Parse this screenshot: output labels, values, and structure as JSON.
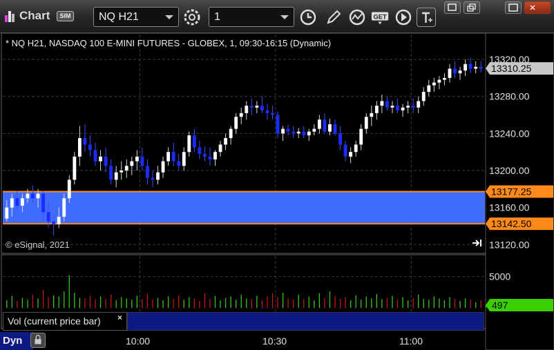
{
  "window": {
    "title": "Chart",
    "badge": "SIM",
    "symbol": "NQ H21",
    "interval": "1",
    "toolbar_icons": [
      "settings-gear-icon",
      "clock-icon",
      "pencil-icon",
      "study-icon",
      "get-icon",
      "play-icon",
      "text-icon"
    ],
    "window_icons": [
      "restore-icon",
      "maximize-icon",
      "minimize-icon",
      "close-icon"
    ],
    "get_label": "GET"
  },
  "chart_data": {
    "type": "candlestick",
    "title": "* NQ H21, NASDAQ 100 E-MINI FUTURES - GLOBEX, 1, 09:30-16:15 (Dynamic)",
    "copyright": "© eSignal, 2021",
    "y_ticks": [
      "13320.00",
      "13280.00",
      "13240.00",
      "13200.00",
      "13160.00",
      "13120.00"
    ],
    "y_tick_values": [
      13320,
      13280,
      13240,
      13200,
      13160,
      13120
    ],
    "ylim": [
      13112,
      13332
    ],
    "x_ticks": [
      "10:00",
      "10:30",
      "11:00"
    ],
    "x_tick_values": [
      "10:00",
      "10:30",
      "11:00"
    ],
    "x_range": [
      "09:30",
      "11:16"
    ],
    "last_price": "13310.25",
    "range_zone": {
      "high": 13177.25,
      "low": 13142.5,
      "high_label": "13177.25",
      "low_label": "13142.50",
      "color": "#3f6bff"
    },
    "up_color": "#ffffff",
    "down_color": "#1a2cff",
    "candles": [
      [
        13148,
        13168,
        13145,
        13160
      ],
      [
        13160,
        13175,
        13150,
        13170
      ],
      [
        13170,
        13178,
        13158,
        13162
      ],
      [
        13162,
        13175,
        13155,
        13170
      ],
      [
        13170,
        13180,
        13165,
        13175
      ],
      [
        13175,
        13184,
        13165,
        13170
      ],
      [
        13170,
        13180,
        13160,
        13175
      ],
      [
        13175,
        13178,
        13145,
        13155
      ],
      [
        13155,
        13165,
        13138,
        13145
      ],
      [
        13145,
        13150,
        13130,
        13142
      ],
      [
        13142,
        13160,
        13138,
        13150
      ],
      [
        13150,
        13175,
        13145,
        13170
      ],
      [
        13170,
        13195,
        13165,
        13190
      ],
      [
        13190,
        13220,
        13185,
        13215
      ],
      [
        13215,
        13248,
        13205,
        13235
      ],
      [
        13235,
        13250,
        13220,
        13228
      ],
      [
        13228,
        13238,
        13215,
        13222
      ],
      [
        13222,
        13230,
        13205,
        13210
      ],
      [
        13210,
        13222,
        13200,
        13215
      ],
      [
        13215,
        13225,
        13198,
        13205
      ],
      [
        13205,
        13212,
        13185,
        13190
      ],
      [
        13190,
        13205,
        13182,
        13198
      ],
      [
        13198,
        13210,
        13190,
        13200
      ],
      [
        13200,
        13212,
        13192,
        13205
      ],
      [
        13205,
        13215,
        13195,
        13210
      ],
      [
        13210,
        13222,
        13200,
        13215
      ],
      [
        13215,
        13225,
        13200,
        13205
      ],
      [
        13205,
        13212,
        13185,
        13192
      ],
      [
        13192,
        13200,
        13182,
        13190
      ],
      [
        13190,
        13205,
        13185,
        13198
      ],
      [
        13198,
        13215,
        13192,
        13210
      ],
      [
        13210,
        13225,
        13205,
        13220
      ],
      [
        13220,
        13230,
        13205,
        13210
      ],
      [
        13210,
        13218,
        13200,
        13205
      ],
      [
        13205,
        13225,
        13200,
        13220
      ],
      [
        13220,
        13242,
        13215,
        13238
      ],
      [
        13238,
        13245,
        13220,
        13225
      ],
      [
        13225,
        13232,
        13212,
        13218
      ],
      [
        13218,
        13226,
        13210,
        13215
      ],
      [
        13215,
        13225,
        13205,
        13212
      ],
      [
        13212,
        13222,
        13205,
        13220
      ],
      [
        13220,
        13232,
        13215,
        13228
      ],
      [
        13228,
        13240,
        13222,
        13235
      ],
      [
        13235,
        13248,
        13228,
        13245
      ],
      [
        13245,
        13262,
        13240,
        13258
      ],
      [
        13258,
        13268,
        13250,
        13262
      ],
      [
        13262,
        13275,
        13255,
        13270
      ],
      [
        13270,
        13278,
        13260,
        13268
      ],
      [
        13268,
        13275,
        13262,
        13270
      ],
      [
        13270,
        13280,
        13262,
        13265
      ],
      [
        13265,
        13272,
        13255,
        13262
      ],
      [
        13262,
        13270,
        13255,
        13260
      ],
      [
        13260,
        13264,
        13235,
        13240
      ],
      [
        13240,
        13248,
        13232,
        13245
      ],
      [
        13245,
        13250,
        13238,
        13242
      ],
      [
        13242,
        13248,
        13235,
        13240
      ],
      [
        13240,
        13246,
        13235,
        13242
      ],
      [
        13242,
        13248,
        13235,
        13238
      ],
      [
        13238,
        13245,
        13232,
        13242
      ],
      [
        13242,
        13250,
        13238,
        13245
      ],
      [
        13245,
        13260,
        13240,
        13255
      ],
      [
        13255,
        13262,
        13240,
        13242
      ],
      [
        13242,
        13256,
        13238,
        13250
      ],
      [
        13250,
        13255,
        13238,
        13240
      ],
      [
        13240,
        13248,
        13222,
        13228
      ],
      [
        13228,
        13232,
        13210,
        13215
      ],
      [
        13215,
        13225,
        13208,
        13220
      ],
      [
        13220,
        13232,
        13215,
        13228
      ],
      [
        13228,
        13250,
        13222,
        13245
      ],
      [
        13245,
        13262,
        13240,
        13258
      ],
      [
        13258,
        13270,
        13248,
        13262
      ],
      [
        13262,
        13275,
        13255,
        13270
      ],
      [
        13270,
        13282,
        13262,
        13275
      ],
      [
        13275,
        13280,
        13265,
        13268
      ],
      [
        13268,
        13275,
        13262,
        13270
      ],
      [
        13270,
        13278,
        13262,
        13265
      ],
      [
        13265,
        13272,
        13258,
        13268
      ],
      [
        13268,
        13275,
        13262,
        13270
      ],
      [
        13270,
        13278,
        13262,
        13268
      ],
      [
        13268,
        13280,
        13262,
        13275
      ],
      [
        13275,
        13290,
        13270,
        13285
      ],
      [
        13285,
        13298,
        13280,
        13292
      ],
      [
        13292,
        13300,
        13285,
        13295
      ],
      [
        13295,
        13302,
        13288,
        13298
      ],
      [
        13298,
        13305,
        13292,
        13300
      ],
      [
        13300,
        13315,
        13295,
        13310
      ],
      [
        13310,
        13318,
        13300,
        13305
      ],
      [
        13305,
        13312,
        13298,
        13308
      ],
      [
        13308,
        13320,
        13302,
        13315
      ],
      [
        13315,
        13322,
        13305,
        13310
      ],
      [
        13310,
        13318,
        13305,
        13312
      ],
      [
        13312,
        13318,
        13306,
        13310
      ]
    ],
    "volume_ticks": [
      "5000"
    ],
    "volume_tick_values": [
      5000
    ],
    "volume_max": 8000,
    "volume_last": "497",
    "volume": [
      1200,
      1900,
      1100,
      1600,
      1300,
      2100,
      1500,
      2800,
      1700,
      2000,
      1800,
      2600,
      5200,
      2400,
      1600,
      1500,
      1900,
      1300,
      1800,
      1400,
      2100,
      1200,
      1700,
      1500,
      1300,
      1900,
      1400,
      2200,
      1300,
      1600,
      1200,
      1800,
      1400,
      2000,
      1300,
      1700,
      1500,
      1100,
      2300,
      1400,
      1900,
      1200,
      1600,
      1800,
      1300,
      2100,
      1500,
      1400,
      1900,
      1200,
      1800,
      2300,
      1700,
      2400,
      1500,
      1300,
      2100,
      1400,
      1800,
      1200,
      2300,
      1600,
      2600,
      1900,
      1400,
      1700,
      1200,
      2000,
      1300,
      1800,
      1500,
      2200,
      1400,
      1600,
      1900,
      1300,
      1700,
      1200,
      1500,
      2100,
      1400,
      1300,
      1800,
      1500,
      1200,
      1700,
      1400,
      1100,
      1500,
      1300,
      900,
      1200,
      497
    ],
    "volume_up": [
      1,
      1,
      0,
      1,
      1,
      0,
      1,
      0,
      0,
      1,
      1,
      1,
      1,
      1,
      1,
      0,
      0,
      0,
      1,
      0,
      0,
      1,
      1,
      1,
      1,
      1,
      0,
      0,
      0,
      1,
      1,
      1,
      0,
      0,
      1,
      1,
      0,
      0,
      0,
      0,
      1,
      1,
      1,
      1,
      1,
      1,
      1,
      0,
      1,
      0,
      0,
      0,
      0,
      1,
      0,
      0,
      1,
      0,
      1,
      1,
      1,
      0,
      1,
      0,
      0,
      0,
      1,
      1,
      1,
      1,
      1,
      1,
      1,
      0,
      1,
      0,
      1,
      1,
      0,
      1,
      1,
      1,
      1,
      1,
      1,
      1,
      0,
      1,
      1,
      0,
      1,
      0,
      1
    ]
  },
  "volume_label": "Vol (current price bar)",
  "close_x": "×",
  "dyn_label": "Dyn",
  "colors": {
    "grid": "#3a3a3a",
    "price_tag": "#c8c8c8",
    "range_tag": "#ff8a1a",
    "volume_tag": "#3ccf00"
  }
}
